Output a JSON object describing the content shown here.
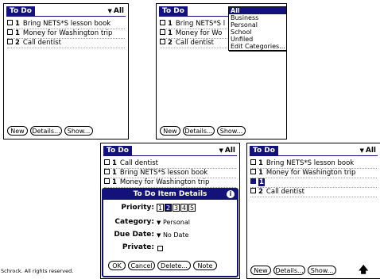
{
  "screen1": {
    "title": "To Do",
    "category": "All",
    "tasks": [
      {
        "priority": "1",
        "text": "Bring NETS*S lesson book"
      },
      {
        "priority": "1",
        "text": "Money for Washington trip"
      },
      {
        "priority": "2",
        "text": "Call dentist"
      }
    ],
    "buttons": {
      "new": "New",
      "details": "Details...",
      "show": "Show..."
    }
  },
  "screen2": {
    "title": "To Do",
    "tasks": [
      {
        "priority": "1",
        "text": "Bring NETS*S l"
      },
      {
        "priority": "1",
        "text": "Money for Wo"
      },
      {
        "priority": "2",
        "text": "Call dentist"
      }
    ],
    "menu": [
      "All",
      "Business",
      "Personal",
      "School",
      "Unfiled",
      "Edit Categories..."
    ],
    "buttons": {
      "new": "New",
      "details": "Details...",
      "show": "Show..."
    }
  },
  "screen3": {
    "title": "To Do",
    "category": "All",
    "tasks": [
      {
        "priority": "1",
        "text": "Call dentist"
      },
      {
        "priority": "1",
        "text": "Bring NETS*S lesson book"
      },
      {
        "priority": "1",
        "text": "Money for Washington trip"
      }
    ],
    "dialog": {
      "title": "To Do Item Details",
      "info_icon": "i",
      "priority_label": "Priority:",
      "priority_options": [
        "1",
        "2",
        "3",
        "4",
        "5"
      ],
      "priority_selected": "2",
      "category_label": "Category:",
      "category_value": "Personal",
      "due_label": "Due Date:",
      "due_value": "No Date",
      "private_label": "Private:",
      "private_checked": false,
      "buttons": {
        "ok": "OK",
        "cancel": "Cancel",
        "delete": "Delete...",
        "note": "Note"
      }
    }
  },
  "screen4": {
    "title": "To Do",
    "category": "All",
    "tasks": [
      {
        "priority": "1",
        "text": "Bring NETS*S lesson book"
      },
      {
        "priority": "1",
        "text": "Money for Washington trip"
      },
      {
        "priority": "1",
        "text": ""
      },
      {
        "priority": "2",
        "text": "Call dentist"
      }
    ],
    "buttons": {
      "new": "New",
      "details": "Details...",
      "show": "Show..."
    },
    "cursor_icon": "up-arrow-icon"
  },
  "footer": "Schrock. All rights reserved.",
  "colors": {
    "title_bar": "#12127a",
    "background": "#ffffff"
  }
}
